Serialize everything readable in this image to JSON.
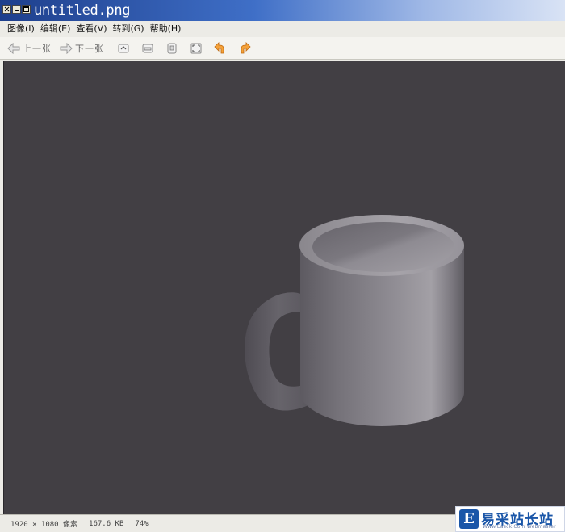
{
  "window": {
    "title": "untitled.png"
  },
  "menu": [
    {
      "label": "图像(I)"
    },
    {
      "label": "编辑(E)"
    },
    {
      "label": "查看(V)"
    },
    {
      "label": "转到(G)"
    },
    {
      "label": "帮助(H)"
    }
  ],
  "toolbar": {
    "prev_label": "上一张",
    "next_label": "下一张",
    "icons": [
      "fit-window-icon",
      "zoom-width-icon",
      "actual-size-icon",
      "fullscreen-icon",
      "rotate-left-icon",
      "rotate-right-icon"
    ]
  },
  "image": {
    "subject": "mug",
    "background_color": "#423f44",
    "mug_color": "#8c8a90"
  },
  "status": {
    "dimensions": "1920 × 1080 像素",
    "file_size": "167.6 KB",
    "zoom": "74%"
  },
  "watermark": {
    "logo_letter": "E",
    "name": "易采站长站",
    "url": "Www.Easck.Com  Webmaster"
  }
}
